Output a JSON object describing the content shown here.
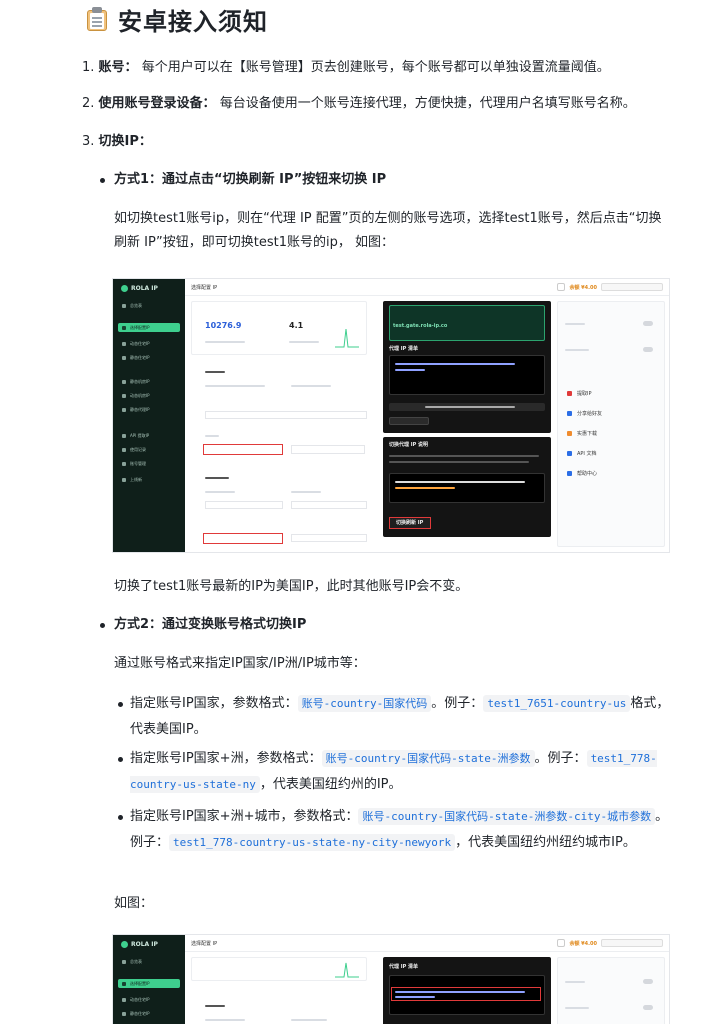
{
  "heading": {
    "icon": "clipboard-icon",
    "title": "安卓接入须知"
  },
  "steps": [
    {
      "num": "1.",
      "label": "账号：",
      "text": "每个用户可以在【账号管理】页去创建账号，每个账号都可以单独设置流量阈值。"
    },
    {
      "num": "2.",
      "label": "使用账号登录设备：",
      "text": "每台设备使用一个账号连接代理，方便快捷，代理用户名填写账号名称。"
    },
    {
      "num": "3.",
      "label": "切换IP：",
      "text": ""
    }
  ],
  "method1": {
    "title": "方式1：通过点击“切换刷新 IP”按钮来切换 IP",
    "desc": "如切换test1账号ip，则在“代理 IP 配置”页的左侧的账号选项，选择test1账号，然后点击“切换刷新 IP”按钮，即可切换test1账号的ip， 如图：",
    "after": "切换了test1账号最新的IP为美国IP，此时其他账号IP会不变。"
  },
  "method2": {
    "title": "方式2：通过变换账号格式切换IP",
    "desc": "通过账号格式来指定IP国家/IP洲/IP城市等：",
    "items": [
      {
        "pre": "指定账号IP国家，参数格式：",
        "fmt": "账号-country-国家代码",
        "mid": "。例子：",
        "ex": "test1_7651-country-us",
        "post": "格式，代表美国IP。"
      },
      {
        "pre": "指定账号IP国家+洲，参数格式：",
        "fmt": "账号-country-国家代码-state-洲参数",
        "mid": "。例子：",
        "ex": "test1_778-country-us-state-ny",
        "post": "，代表美国纽约州的IP。"
      },
      {
        "pre": "指定账号IP国家+洲+城市，参数格式：",
        "fmt": "账号-country-国家代码-state-洲参数-city-城市参数",
        "mid": "。例子：",
        "ex": "test1_778-country-us-state-ny-city-newyork",
        "post": "，代表美国纽约州纽约城市IP。"
      }
    ],
    "figure_label": "如图："
  },
  "screenshot": {
    "brand": "ROLA IP",
    "balance": "余额 ¥4.00",
    "page_title": "选择配置 IP",
    "stat1": "10276.9",
    "stat2": "4.1",
    "nav": [
      "总览表",
      "选择配置IP",
      "动态住宅IP",
      "静态住宅IP",
      "静态机房IP",
      "动态机房IP",
      "静态代理IP",
      "API 提取IP",
      "使用记录",
      "账号管理",
      "上线新"
    ],
    "code_host": "test.gate.rola-ip.co",
    "cmd": "https://testnetwork.rola-ip.co/refresh?user=test1_2956&country=us&state=&city=",
    "refresh_btn": "切换刷新 IP",
    "rail": [
      "提取IP",
      "分享给好友",
      "实惠下载",
      "API 文档",
      "帮助中心"
    ]
  },
  "colors": {
    "code": "#1e6fd9",
    "accent": "#3ecf8e",
    "balance": "#e08a1e",
    "highlight": "#e03a3a"
  }
}
